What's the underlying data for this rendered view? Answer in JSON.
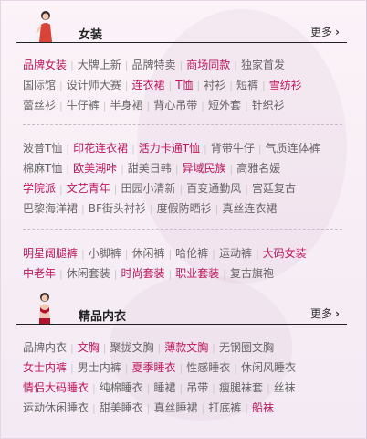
{
  "section1": {
    "title": "女装",
    "more": "更多",
    "groups": [
      [
        [
          {
            "t": "品牌女装",
            "h": true
          },
          {
            "t": "大牌上新",
            "h": false
          },
          {
            "t": "品牌特卖",
            "h": false
          },
          {
            "t": "商场同款",
            "h": true
          },
          {
            "t": "独家首发",
            "h": false
          }
        ],
        [
          {
            "t": "国际馆",
            "h": false
          },
          {
            "t": "设计师大赛",
            "h": false
          },
          {
            "t": "连衣裙",
            "h": true
          },
          {
            "t": "T恤",
            "h": true
          },
          {
            "t": "衬衫",
            "h": false
          },
          {
            "t": "短裤",
            "h": false
          },
          {
            "t": "雪纺衫",
            "h": true
          }
        ],
        [
          {
            "t": "蕾丝衫",
            "h": false
          },
          {
            "t": "牛仔裤",
            "h": false
          },
          {
            "t": "半身裙",
            "h": false
          },
          {
            "t": "背心吊带",
            "h": false
          },
          {
            "t": "短外套",
            "h": false
          },
          {
            "t": "针织衫",
            "h": false
          }
        ]
      ],
      [
        [
          {
            "t": "波普T恤",
            "h": false
          },
          {
            "t": "印花连衣裙",
            "h": true
          },
          {
            "t": "活力卡通T恤",
            "h": true
          },
          {
            "t": "背带牛仔",
            "h": false
          },
          {
            "t": "气质连体裤",
            "h": false
          }
        ],
        [
          {
            "t": "棉麻T恤",
            "h": false
          },
          {
            "t": "欧美潮咔",
            "h": true
          },
          {
            "t": "甜美日韩",
            "h": false
          },
          {
            "t": "异域民族",
            "h": true
          },
          {
            "t": "高雅名媛",
            "h": false
          }
        ],
        [
          {
            "t": "学院派",
            "h": true
          },
          {
            "t": "文艺青年",
            "h": true
          },
          {
            "t": "田园小清新",
            "h": false
          },
          {
            "t": "百变通勤风",
            "h": false
          },
          {
            "t": "宫廷复古",
            "h": false
          }
        ],
        [
          {
            "t": "巴黎海洋裙",
            "h": false
          },
          {
            "t": "BF街头衬衫",
            "h": false
          },
          {
            "t": "度假防晒衫",
            "h": false
          },
          {
            "t": "真丝连衣裙",
            "h": false
          }
        ]
      ],
      [
        [
          {
            "t": "明星阔腿裤",
            "h": true
          },
          {
            "t": "小脚裤",
            "h": false
          },
          {
            "t": "休闲裤",
            "h": false
          },
          {
            "t": "哈伦裤",
            "h": false
          },
          {
            "t": "运动裤",
            "h": false
          },
          {
            "t": "大码女装",
            "h": true
          }
        ],
        [
          {
            "t": "中老年",
            "h": true
          },
          {
            "t": "休闲套装",
            "h": false
          },
          {
            "t": "时尚套装",
            "h": true
          },
          {
            "t": "职业套装",
            "h": true
          },
          {
            "t": "复古旗袍",
            "h": false
          }
        ]
      ]
    ]
  },
  "section2": {
    "title": "精品内衣",
    "more": "更多",
    "groups": [
      [
        [
          {
            "t": "品牌内衣",
            "h": false
          },
          {
            "t": "文胸",
            "h": true
          },
          {
            "t": "聚拢文胸",
            "h": false
          },
          {
            "t": "薄款文胸",
            "h": true
          },
          {
            "t": "无钢圈文胸",
            "h": false
          }
        ],
        [
          {
            "t": "女士内裤",
            "h": true
          },
          {
            "t": "男士内裤",
            "h": false
          },
          {
            "t": "夏季睡衣",
            "h": true
          },
          {
            "t": "性感睡衣",
            "h": false
          },
          {
            "t": "休闲风睡衣",
            "h": false
          }
        ],
        [
          {
            "t": "情侣大码睡衣",
            "h": true
          },
          {
            "t": "纯棉睡衣",
            "h": false
          },
          {
            "t": "睡裙",
            "h": false
          },
          {
            "t": "吊带",
            "h": false
          },
          {
            "t": "瘦腿袜套",
            "h": false
          },
          {
            "t": "丝袜",
            "h": false
          }
        ],
        [
          {
            "t": "运动休闲睡衣",
            "h": false
          },
          {
            "t": "甜美睡衣",
            "h": false
          },
          {
            "t": "真丝睡裙",
            "h": false
          },
          {
            "t": "打底裤",
            "h": false
          },
          {
            "t": "船袜",
            "h": true
          }
        ]
      ]
    ]
  },
  "colors": {
    "highlight": "#c2185b",
    "normal": "#666666",
    "separator": "#c9c9c9"
  }
}
